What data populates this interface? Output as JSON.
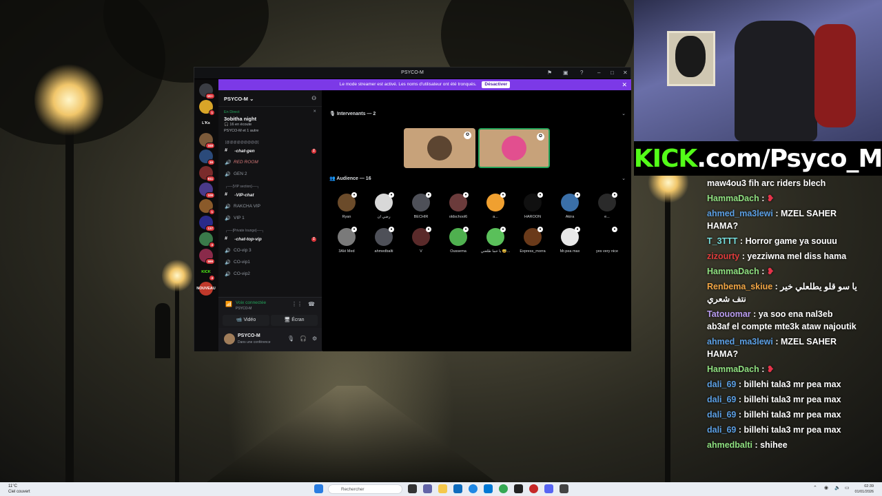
{
  "stream": {
    "kick_brand": "KICK",
    "kick_url": ".com/Psyco_M"
  },
  "chat": [
    {
      "user": "",
      "text": "maw4ou3 fih arc riders blech",
      "color": "u-lgreen"
    },
    {
      "user": "HammaDach",
      "text": "",
      "color": "u-lgreen"
    },
    {
      "user": "ahmed_ma3lewi",
      "text": "MZEL SAHER HAMA?",
      "color": "u-blue"
    },
    {
      "user": "T_3TTT",
      "text": "Horror game ya souuu",
      "color": "u-cyan"
    },
    {
      "user": "zizourty",
      "text": "yezziwna mel diss hama",
      "color": "u-red"
    },
    {
      "user": "HammaDach",
      "text": "",
      "color": "u-lgreen"
    },
    {
      "user": "Renbema_skiue",
      "text": "يا سو قلو يطلعلي خير نتف شعري",
      "color": "u-orange"
    },
    {
      "user": "Tatouomar",
      "text": "ya soo ena nal3eb ab3af el compte mte3k ataw najoutik",
      "color": "u-purple"
    },
    {
      "user": "ahmed_ma3lewi",
      "text": "MZEL SAHER HAMA?",
      "color": "u-blue"
    },
    {
      "user": "HammaDach",
      "text": "",
      "color": "u-lgreen"
    },
    {
      "user": "dali_69",
      "text": "billehi tala3 mr pea max",
      "color": "u-blue"
    },
    {
      "user": "dali_69",
      "text": "billehi tala3 mr pea max",
      "color": "u-blue"
    },
    {
      "user": "dali_69",
      "text": "billehi tala3 mr pea max",
      "color": "u-blue"
    },
    {
      "user": "dali_69",
      "text": "billehi tala3 mr pea max",
      "color": "u-blue"
    },
    {
      "user": "ahmedbalti",
      "text": "shihee",
      "color": "u-lgreen"
    }
  ],
  "discord": {
    "title": "PSYCO-M",
    "banner_text": "Le mode streamer est activé. Les noms d'utilisateur ont été tronqués.",
    "banner_button": "Désactiver",
    "rail": [
      {
        "label": "",
        "badge": "1K+"
      },
      {
        "label": "",
        "badge": "1"
      },
      {
        "label": "L'Ks",
        "badge": ""
      },
      {
        "label": "",
        "badge": "348"
      },
      {
        "label": "",
        "badge": "16"
      },
      {
        "label": "",
        "badge": "611"
      },
      {
        "label": "",
        "badge": "108"
      },
      {
        "label": "",
        "badge": "1"
      },
      {
        "label": "",
        "badge": "137"
      },
      {
        "label": "",
        "badge": "4"
      },
      {
        "label": "",
        "badge": "599"
      },
      {
        "label": "KICK",
        "badge": "4"
      },
      {
        "label": "NOUVEAU",
        "badge": ""
      }
    ],
    "server_name": "PSYCO-M",
    "live_label": "En Direct",
    "live_title": "3obitha night",
    "live_listeners": "16 en écoute",
    "live_hosts": "PSYCO-M et 1 autre",
    "categories": [
      {
        "title": "[@@@@@@@@@]",
        "channels": [
          {
            "icon": "#",
            "name": "۰chat-gen",
            "active": true,
            "ping": "1",
            "red": false
          },
          {
            "icon": "🔊",
            "name": "RED ROOM",
            "active": false,
            "ping": "",
            "red": true
          },
          {
            "icon": "🔊",
            "name": "GEN 2",
            "active": false,
            "ping": "",
            "red": false
          }
        ]
      },
      {
        "title": "┌──[VIP section]──┐",
        "channels": [
          {
            "icon": "#",
            "name": "۰VIP-chat",
            "active": true,
            "ping": "",
            "red": false
          },
          {
            "icon": "🔊",
            "name": "RAKCHA VIP",
            "active": false,
            "ping": "",
            "red": false
          },
          {
            "icon": "🔊",
            "name": "VIP 1",
            "active": false,
            "ping": "",
            "red": false
          }
        ]
      },
      {
        "title": "┌──[Private lounge]──┐",
        "channels": [
          {
            "icon": "#",
            "name": "۰chat-top-vip",
            "active": true,
            "ping": "1",
            "red": false
          },
          {
            "icon": "🔊",
            "name": "CO-vip 3",
            "active": false,
            "ping": "",
            "red": false
          },
          {
            "icon": "🔊",
            "name": "CO-vip1",
            "active": false,
            "ping": "",
            "red": false
          },
          {
            "icon": "🔊",
            "name": "CO-vip2",
            "active": false,
            "ping": "",
            "red": false
          }
        ]
      }
    ],
    "voice_connected": "Voix connectée",
    "voice_server": "PSYCO-M",
    "video_label": "Vidéo",
    "screen_label": "Écran",
    "user_name": "PSYCO-M",
    "user_status": "Dans une conférence",
    "speakers_label": "Intervenants — 2",
    "audience_label": "Audience — 16",
    "audience": [
      {
        "name": "Ryan",
        "color": "#6b4b2a"
      },
      {
        "name": "رضي ان",
        "color": "#d8d8d8"
      },
      {
        "name": "BECHIR",
        "color": "#4e5058"
      },
      {
        "name": "oldschool6",
        "color": "#6b3b3b"
      },
      {
        "name": "a...",
        "color": "#f0a030"
      },
      {
        "name": "HAROON",
        "color": "#101010"
      },
      {
        "name": "Akira",
        "color": "#3a6fa8"
      },
      {
        "name": "e...",
        "color": "#2a2a2a"
      },
      {
        "name": "3Alé Med",
        "color": "#7a7a7a"
      },
      {
        "name": "ahmedbalti",
        "color": "#4e5058"
      },
      {
        "name": "V",
        "color": "#5a2a2a"
      },
      {
        "name": "Oussema",
        "color": "#4fb04f"
      },
      {
        "name": "يا حما طلعني 😅...",
        "color": "#5ac05a"
      },
      {
        "name": "Express_morra",
        "color": "#6a3a1a"
      },
      {
        "name": "Mr.pea max",
        "color": "#e8e8e8"
      },
      {
        "name": "yes very nice",
        "color": "#000000"
      }
    ]
  },
  "taskbar": {
    "weather_temp": "11°C",
    "weather_desc": "Ciel couvert",
    "search_placeholder": "Rechercher",
    "time": "02:39",
    "date": "01/01/2026"
  }
}
